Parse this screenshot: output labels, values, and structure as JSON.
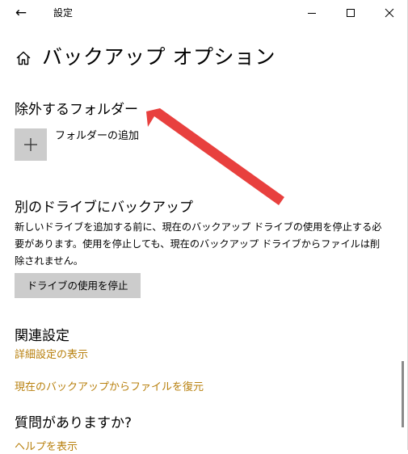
{
  "window": {
    "title": "設定",
    "back_icon": "arrow-left-icon",
    "controls": [
      "minimize-icon",
      "maximize-icon",
      "close-icon"
    ]
  },
  "header": {
    "home_icon": "home-icon",
    "title": "バックアップ オプション"
  },
  "exclude": {
    "title": "除外するフォルダー",
    "add_icon": "plus-icon",
    "add_label": "フォルダーの追加"
  },
  "other_drive": {
    "title": "別のドライブにバックアップ",
    "description": "新しいドライブを追加する前に、現在のバックアップ ドライブの使用を停止する必要があります。使用を停止しても、現在のバックアップ ドライブからファイルは削除されません。",
    "stop_button": "ドライブの使用を停止"
  },
  "related": {
    "title": "関連設定",
    "links": [
      "詳細設定の表示",
      "現在のバックアップからファイルを復元"
    ]
  },
  "questions": {
    "title": "質問がありますか?",
    "help_link": "ヘルプを表示"
  },
  "colors": {
    "link": "#b8800e",
    "button_bg": "#cccccc",
    "annotation": "#e8403e"
  }
}
